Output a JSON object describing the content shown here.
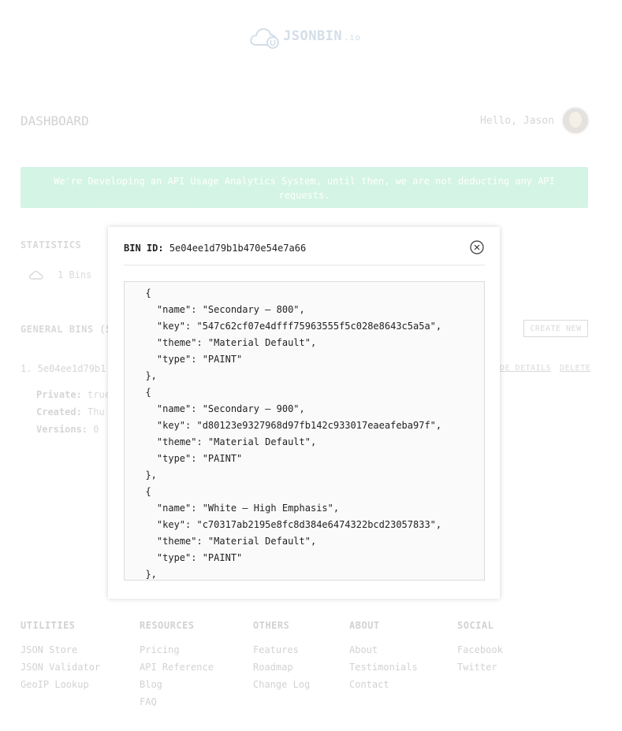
{
  "header": {
    "logo_text": "JSONBIN",
    "logo_suffix": ".io",
    "logo_icon": "cloud-icon"
  },
  "dashboard": {
    "title": "DASHBOARD",
    "greeting": "Hello, Jason"
  },
  "banner": {
    "text": "We're Developing an API Usage Analytics System, until then, we are not deducting any API requests.",
    "color": "#3ecf8e"
  },
  "statistics": {
    "title": "STATISTICS",
    "bins_count": "1 Bins"
  },
  "general_bins": {
    "title": "GENERAL BINS (S",
    "create_button": "CREATE NEW",
    "bin": {
      "index_id": "1. 5e04ee1d79b1",
      "details_link": "DE DETAILS",
      "delete_link": "DELETE"
    },
    "meta": [
      {
        "label": "Private:",
        "value": "true"
      },
      {
        "label": "Created:",
        "value": "Thu"
      },
      {
        "label": "Versions:",
        "value": "0"
      }
    ]
  },
  "footer": {
    "columns": [
      {
        "head": "UTILITIES",
        "links": [
          "JSON Store",
          "JSON Validator",
          "GeoIP Lookup"
        ]
      },
      {
        "head": "RESOURCES",
        "links": [
          "Pricing",
          "API Reference",
          "Blog",
          "FAQ"
        ]
      },
      {
        "head": "OTHERS",
        "links": [
          "Features",
          "Roadmap",
          "Change Log"
        ]
      },
      {
        "head": "ABOUT",
        "links": [
          "About",
          "Testimonials",
          "Contact"
        ]
      },
      {
        "head": "SOCIAL",
        "links": [
          "Facebook",
          "Twitter"
        ]
      }
    ]
  },
  "modal": {
    "bin_id_label": "BIN ID:",
    "bin_id": "5e04ee1d79b1b470e54e7a66",
    "code": "  {\n    \"name\": \"Secondary – 800\",\n    \"key\": \"547c62cf07e4dfff75963555f5c028e8643c5a5a\",\n    \"theme\": \"Material Default\",\n    \"type\": \"PAINT\"\n  },\n  {\n    \"name\": \"Secondary – 900\",\n    \"key\": \"d80123e9327968d97fb142c933017eaeafeba97f\",\n    \"theme\": \"Material Default\",\n    \"type\": \"PAINT\"\n  },\n  {\n    \"name\": \"White – High Emphasis\",\n    \"key\": \"c70317ab2195e8fc8d384e6474322bcd23057833\",\n    \"theme\": \"Material Default\",\n    \"type\": \"PAINT\"\n  },"
  }
}
